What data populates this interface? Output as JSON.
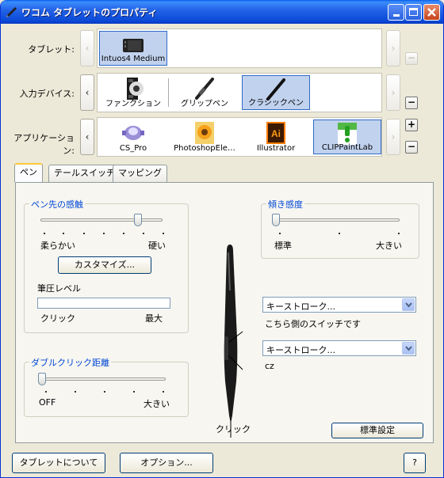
{
  "window": {
    "title": "ワコム タブレットのプロパティ"
  },
  "rows": {
    "tablet": {
      "label": "タブレット:",
      "items": [
        "Intuos4 Medium"
      ]
    },
    "device": {
      "label": "入力デバイス:",
      "items": [
        "ファンクション",
        "グリップペン",
        "クラシックペン"
      ]
    },
    "app": {
      "label": "アプリケーション:",
      "items": [
        "CS_Pro",
        "PhotoshopEle…",
        "Illustrator",
        "CLIPPaintLab"
      ]
    }
  },
  "icons": {
    "plus": "+",
    "minus": "−",
    "left": "‹",
    "right": "›",
    "illustrator_text": "Ai"
  },
  "tabs": [
    "ペン",
    "テールスイッチ",
    "マッピング"
  ],
  "tip_feel": {
    "title": "ペン先の感触",
    "soft": "柔らかい",
    "firm": "硬い",
    "customize": "カスタマイズ...",
    "pressure_label": "筆圧レベル",
    "click": "クリック",
    "max": "最大",
    "slider_value_percent": 80
  },
  "tilt": {
    "title": "傾き感度",
    "normal": "標準",
    "high": "大きい",
    "slider_value_percent": 0
  },
  "double_click": {
    "title": "ダブルクリック距離",
    "off": "OFF",
    "large": "大きい",
    "slider_value_percent": 0
  },
  "pen_buttons": {
    "upper_value": "キーストローク...",
    "upper_caption": "こちら側のスイッチです",
    "lower_value": "キーストローク...",
    "lower_caption": "cz",
    "tip_caption": "クリック"
  },
  "buttons": {
    "default": "標準設定",
    "about": "タブレットについて",
    "options": "オプション...",
    "help": "?"
  }
}
